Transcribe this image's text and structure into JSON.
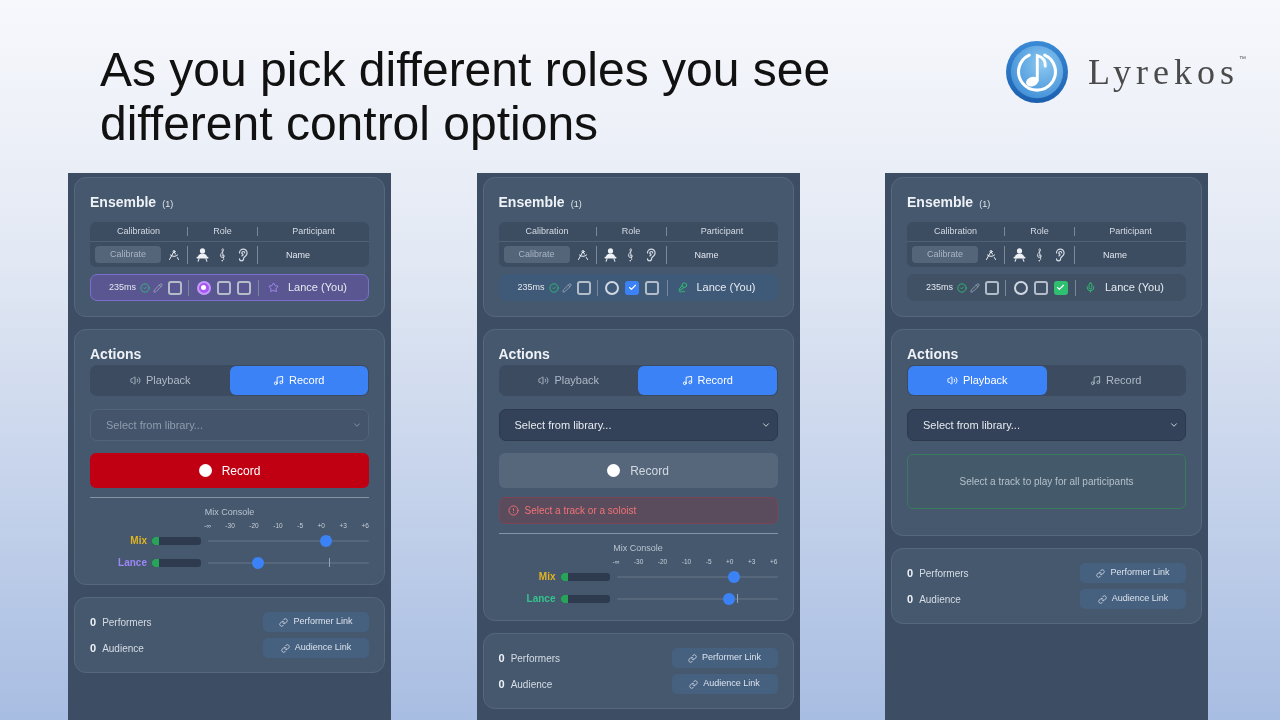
{
  "slide": {
    "title": "As you pick different roles you see different control options",
    "logo": {
      "wordmark": "Lyrekos",
      "trademark": "™"
    }
  },
  "panels": [
    {
      "ensemble": {
        "title": "Ensemble",
        "count": "(1)",
        "columns": [
          "Calibration",
          "Role",
          "Participant"
        ],
        "calibrate_button": "Calibrate",
        "name_header": "Name",
        "participants": [
          {
            "latency": "235ms",
            "calibrated": true,
            "calibration_checked": false,
            "roles": [
              {
                "kind": "conductor",
                "checked": true
              },
              {
                "kind": "soloist",
                "checked": false
              },
              {
                "kind": "listener",
                "checked": false
              }
            ],
            "name": "Lance (You)"
          }
        ]
      },
      "actions": {
        "title": "Actions",
        "tabs": [
          {
            "label": "Playback",
            "selected": false
          },
          {
            "label": "Record",
            "selected": true
          }
        ],
        "library_select": {
          "placeholder": "Select from library...",
          "disabled": true
        },
        "record_button": {
          "label": "Record",
          "disabled": false
        },
        "mix_console": {
          "title": "Mix Console",
          "scale": [
            "-∞",
            "-30",
            "-20",
            "-10",
            "-5",
            "+0",
            "+3",
            "+6"
          ],
          "channels": [
            {
              "name": "Mix",
              "color": "#e0b422",
              "meter": {
                "level": 0.15
              },
              "fader": {
                "level": 0.73
              }
            },
            {
              "name": "Lance",
              "color": "#9b87f5",
              "meter": {
                "level": 0.15
              },
              "fader": {
                "level": 0.31
              }
            }
          ]
        }
      },
      "links": {
        "rows": [
          {
            "count": "0",
            "label": "Performers",
            "button": "Performer Link"
          },
          {
            "count": "0",
            "label": "Audience",
            "button": "Audience Link"
          }
        ]
      }
    },
    {
      "ensemble": {
        "title": "Ensemble",
        "count": "(1)",
        "columns": [
          "Calibration",
          "Role",
          "Participant"
        ],
        "calibrate_button": "Calibrate",
        "name_header": "Name",
        "participants": [
          {
            "latency": "235ms",
            "calibrated": true,
            "calibration_checked": false,
            "roles": [
              {
                "kind": "conductor",
                "checked": false
              },
              {
                "kind": "soloist",
                "checked": true
              },
              {
                "kind": "listener",
                "checked": false
              }
            ],
            "name": "Lance (You)"
          }
        ]
      },
      "actions": {
        "title": "Actions",
        "tabs": [
          {
            "label": "Playback",
            "selected": false
          },
          {
            "label": "Record",
            "selected": true
          }
        ],
        "library_select": {
          "placeholder": "Select from library...",
          "disabled": false
        },
        "record_button": {
          "label": "Record",
          "disabled": true
        },
        "alert": {
          "text": "Select a track or a soloist"
        },
        "mix_console": {
          "title": "Mix Console",
          "scale": [
            "-∞",
            "-30",
            "-20",
            "-10",
            "-5",
            "+0",
            "+3",
            "+6"
          ],
          "channels": [
            {
              "name": "Mix",
              "color": "#e0b422",
              "meter": {
                "level": 0.15
              },
              "fader": {
                "level": 0.73
              }
            },
            {
              "name": "Lance",
              "color": "#34c48b",
              "meter": {
                "level": 0.15
              },
              "fader": {
                "level": 0.7
              }
            }
          ]
        }
      },
      "links": {
        "rows": [
          {
            "count": "0",
            "label": "Performers",
            "button": "Performer Link"
          },
          {
            "count": "0",
            "label": "Audience",
            "button": "Audience Link"
          }
        ]
      }
    },
    {
      "ensemble": {
        "title": "Ensemble",
        "count": "(1)",
        "columns": [
          "Calibration",
          "Role",
          "Participant"
        ],
        "calibrate_button": "Calibrate",
        "name_header": "Name",
        "participants": [
          {
            "latency": "235ms",
            "calibrated": true,
            "calibration_checked": false,
            "roles": [
              {
                "kind": "conductor",
                "checked": false
              },
              {
                "kind": "soloist",
                "checked": false
              },
              {
                "kind": "listener",
                "checked": true
              }
            ],
            "name": "Lance (You)"
          }
        ]
      },
      "actions": {
        "title": "Actions",
        "tabs": [
          {
            "label": "Playback",
            "selected": true
          },
          {
            "label": "Record",
            "selected": false
          }
        ],
        "library_select": {
          "placeholder": "Select from library...",
          "disabled": false
        },
        "hint": {
          "text": "Select a track to play for all participants"
        }
      },
      "links": {
        "rows": [
          {
            "count": "0",
            "label": "Performers",
            "button": "Performer Link"
          },
          {
            "count": "0",
            "label": "Audience",
            "button": "Audience Link"
          }
        ]
      }
    }
  ]
}
